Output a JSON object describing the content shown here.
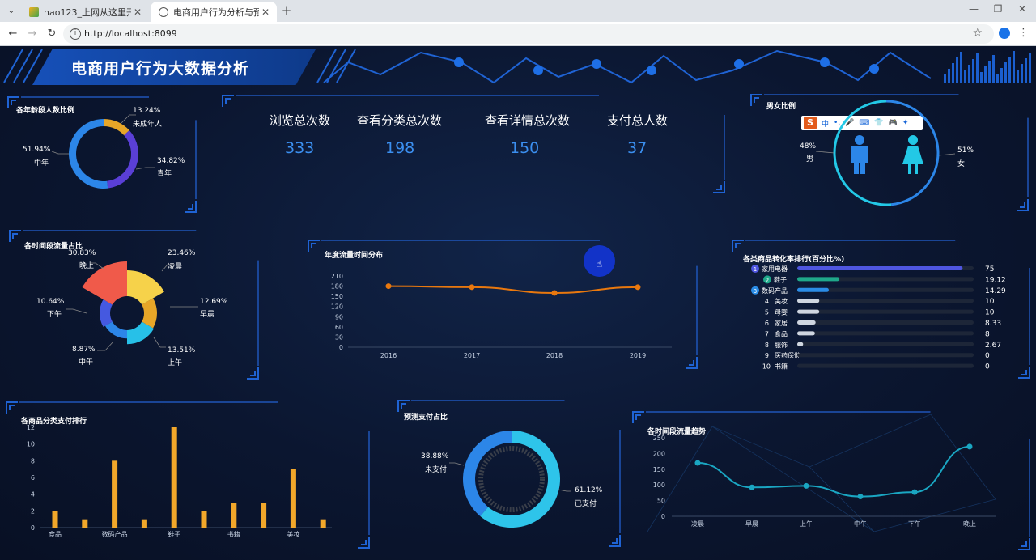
{
  "browser": {
    "tabs": [
      {
        "label": "hao123_上网从这里开始",
        "active": false
      },
      {
        "label": "电商用户行为分析与预测",
        "active": true
      }
    ],
    "url": "http://localhost:8099"
  },
  "dashboard": {
    "title": "电商用户行为大数据分析",
    "stats": [
      {
        "label": "浏览总次数",
        "value": "333"
      },
      {
        "label": "查看分类总次数",
        "value": "198"
      },
      {
        "label": "查看详情总次数",
        "value": "150"
      },
      {
        "label": "支付总人数",
        "value": "37"
      }
    ],
    "ime_toolbar": {
      "items": [
        "中",
        "•,",
        "🎤",
        "⌨",
        "👕",
        "🎮",
        "✦"
      ]
    }
  },
  "chart_data": [
    {
      "type": "pie",
      "title": "各年龄段人数比例",
      "categories": [
        "未成年人",
        "青年",
        "中年"
      ],
      "values": [
        13.24,
        34.82,
        51.94
      ],
      "labels": [
        "13.24%",
        "34.82%",
        "51.94%"
      ],
      "colors": [
        "#e7a628",
        "#5a3fd6",
        "#2c86e8"
      ]
    },
    {
      "type": "pie",
      "title": "男女比例",
      "categories": [
        "男",
        "女"
      ],
      "values": [
        48,
        51
      ],
      "labels": [
        "48%",
        "51%"
      ],
      "colors": [
        "#2c86e8",
        "#23c8e6"
      ]
    },
    {
      "type": "pie",
      "title": "各时间段流量占比",
      "categories": [
        "凌晨",
        "早晨",
        "上午",
        "中午",
        "下午",
        "晚上"
      ],
      "values": [
        23.46,
        12.69,
        13.51,
        8.87,
        10.64,
        30.83
      ],
      "labels": [
        "23.46%",
        "12.69%",
        "13.51%",
        "8.87%",
        "10.64%",
        "30.83%"
      ],
      "colors": [
        "#f6d24a",
        "#e7a628",
        "#27c0e8",
        "#2c86e8",
        "#4559e0",
        "#f05a4a"
      ]
    },
    {
      "type": "line",
      "title": "年度流量时间分布",
      "x": [
        "2016",
        "2017",
        "2018",
        "2019"
      ],
      "series": [
        {
          "values": [
            180,
            177,
            160,
            177
          ]
        }
      ],
      "yticks": [
        0,
        30,
        60,
        90,
        120,
        150,
        180,
        210
      ],
      "ylim": [
        0,
        210
      ],
      "color": "#e9780e"
    },
    {
      "type": "bar",
      "title": "各类商品转化率排行(百分比%)",
      "categories": [
        "家用电器",
        "鞋子",
        "数码产品",
        "美妆",
        "母婴",
        "家居",
        "食品",
        "服饰",
        "医药保健",
        "书籍"
      ],
      "ranks": [
        "1",
        "2",
        "3",
        "4",
        "5",
        "6",
        "7",
        "8",
        "9",
        "10"
      ],
      "values": [
        75,
        19.12,
        14.29,
        10,
        10,
        8.33,
        8,
        2.67,
        0,
        0
      ],
      "value_labels": [
        "75",
        "19.12",
        "14.29",
        "10",
        "10",
        "8.33",
        "8",
        "2.67",
        "0",
        "0"
      ],
      "xlim": [
        0,
        80
      ],
      "colors": [
        "#4f56e0",
        "#1fa88a",
        "#2a8ce6",
        "#cfd6e0",
        "#cfd6e0",
        "#cfd6e0",
        "#cfd6e0",
        "#cfd6e0",
        "#cfd6e0",
        "#cfd6e0"
      ]
    },
    {
      "type": "bar",
      "title": "各商品分类支付排行",
      "categories": [
        "食品",
        "",
        "数码产品",
        "",
        "鞋子",
        "",
        "书籍",
        "",
        "美妆",
        ""
      ],
      "values": [
        2,
        1,
        8,
        1,
        12,
        2,
        3,
        3,
        7,
        1
      ],
      "yticks": [
        0,
        2,
        4,
        6,
        8,
        10,
        12
      ],
      "ylim": [
        0,
        12
      ],
      "color": "#f2a72a"
    },
    {
      "type": "pie",
      "title": "预测支付占比",
      "categories": [
        "未支付",
        "已支付"
      ],
      "values": [
        38.88,
        61.12
      ],
      "labels": [
        "38.88%",
        "61.12%"
      ],
      "colors": [
        "#2c86e8",
        "#2ec4ea"
      ]
    },
    {
      "type": "line",
      "title": "各时间段流量趋势",
      "x": [
        "凌晨",
        "早晨",
        "上午",
        "中午",
        "下午",
        "晚上"
      ],
      "series": [
        {
          "values": [
            170,
            92,
            97,
            63,
            77,
            222
          ]
        }
      ],
      "yticks": [
        0,
        50,
        100,
        150,
        200,
        250
      ],
      "ylim": [
        0,
        250
      ],
      "color": "#1aa6c2"
    }
  ]
}
